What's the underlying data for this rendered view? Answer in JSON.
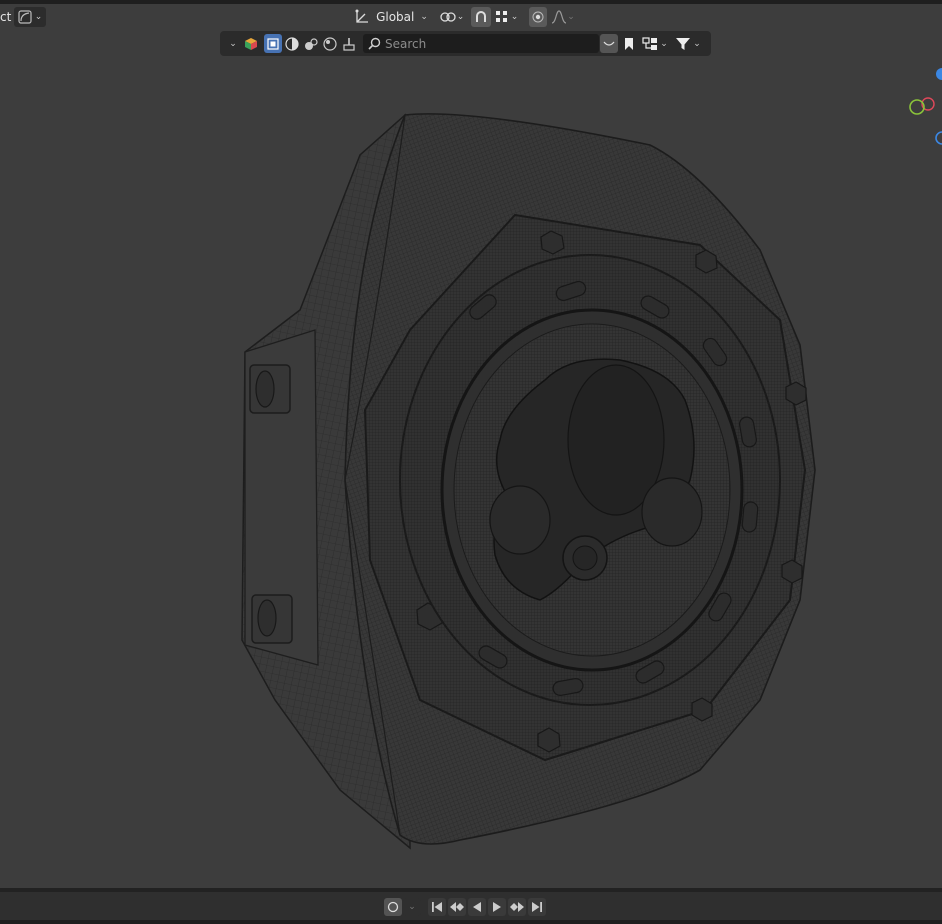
{
  "header": {
    "mode_fragment": "ct",
    "transform_orientation": "Global",
    "search_placeholder": "Search"
  },
  "colors": {
    "background": "#3d3d3d",
    "bar": "#2b2b2b",
    "accent_selected": "#4772b3",
    "gizmo_x": "#e0485a",
    "gizmo_y": "#8bc43a",
    "gizmo_z": "#3b87e3"
  },
  "icons": {
    "header": [
      "editor-type-icon",
      "chevron-down-icon",
      "transform-orientation-icon",
      "pivot-icon",
      "snap-icon",
      "snap-element-icon",
      "proportional-edit-icon",
      "falloff-icon"
    ],
    "outliner": [
      "filter-expand-icon",
      "color-cube-icon",
      "restrict-select-icon",
      "display-solid-icon",
      "material-preview-icon",
      "rendered-icon",
      "world-icon",
      "brush-icon",
      "search-icon",
      "link-icon",
      "bookmark-icon",
      "hierarchy-icon",
      "funnel-icon"
    ],
    "timeline": [
      "record-icon",
      "jump-start-icon",
      "prev-keyframe-icon",
      "play-reverse-icon",
      "play-icon",
      "next-keyframe-icon",
      "jump-end-icon"
    ]
  }
}
